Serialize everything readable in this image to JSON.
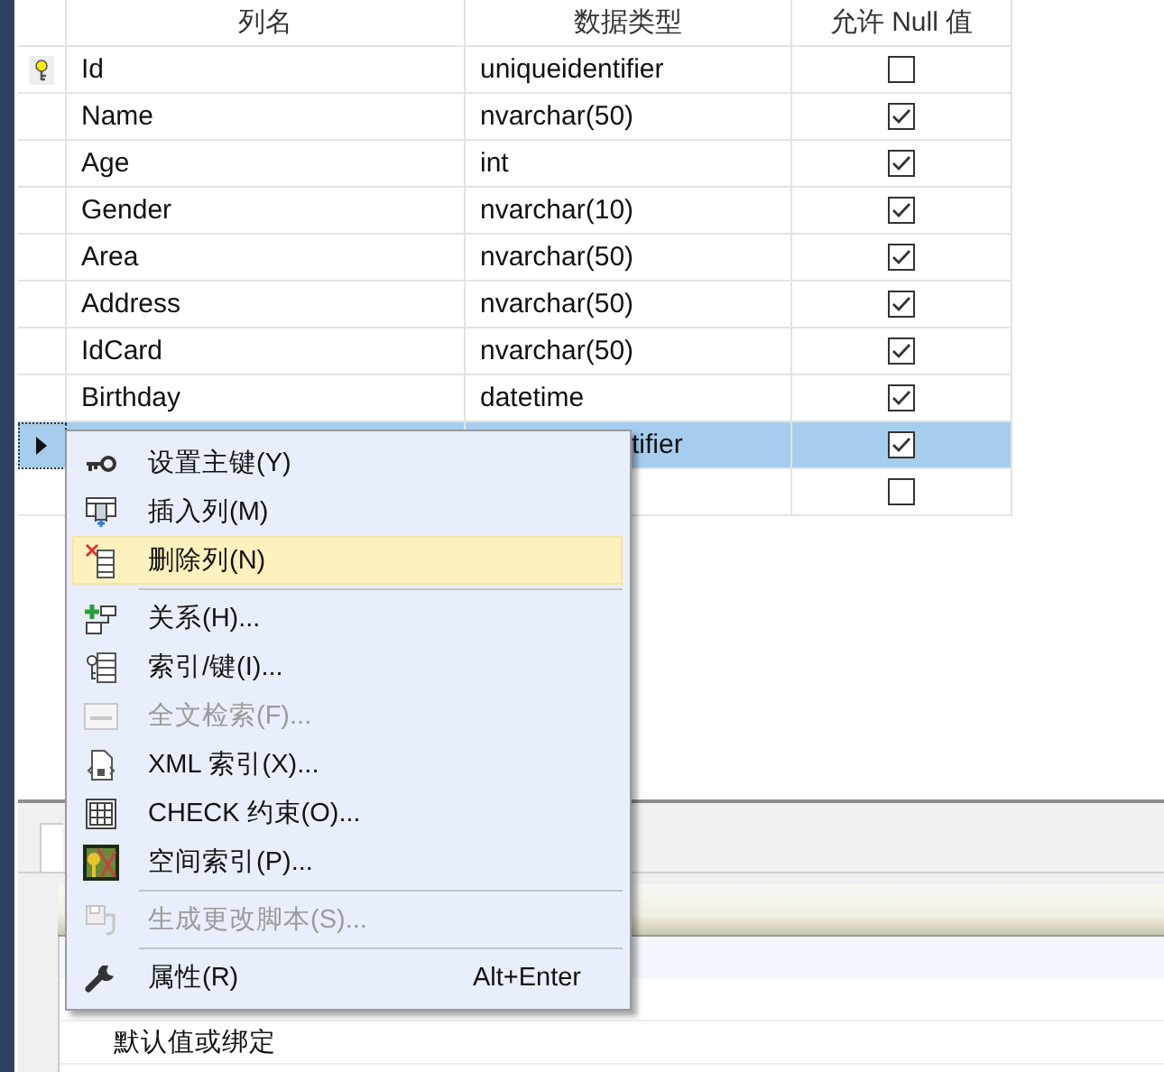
{
  "table": {
    "columns": [
      "列名",
      "数据类型",
      "允许 Null 值"
    ],
    "rows": [
      {
        "name": "Id",
        "data_type": "uniqueidentifier",
        "allow_null": false,
        "primary_key": true,
        "selected": false
      },
      {
        "name": "Name",
        "data_type": "nvarchar(50)",
        "allow_null": true,
        "primary_key": false,
        "selected": false
      },
      {
        "name": "Age",
        "data_type": "int",
        "allow_null": true,
        "primary_key": false,
        "selected": false
      },
      {
        "name": "Gender",
        "data_type": "nvarchar(10)",
        "allow_null": true,
        "primary_key": false,
        "selected": false
      },
      {
        "name": "Area",
        "data_type": "nvarchar(50)",
        "allow_null": true,
        "primary_key": false,
        "selected": false
      },
      {
        "name": "Address",
        "data_type": "nvarchar(50)",
        "allow_null": true,
        "primary_key": false,
        "selected": false
      },
      {
        "name": "IdCard",
        "data_type": "nvarchar(50)",
        "allow_null": true,
        "primary_key": false,
        "selected": false
      },
      {
        "name": "Birthday",
        "data_type": "datetime",
        "allow_null": true,
        "primary_key": false,
        "selected": false
      },
      {
        "data_type": "tifier",
        "allow_null": true,
        "primary_key": false,
        "selected": true
      },
      {
        "allow_null": false,
        "primary_key": false,
        "selected": false
      }
    ]
  },
  "context_menu": {
    "items": [
      {
        "kind": "item",
        "label": "设置主键(Y)",
        "disabled": false,
        "selected": false
      },
      {
        "kind": "item",
        "label": "插入列(M)",
        "disabled": false,
        "selected": false
      },
      {
        "kind": "item",
        "label": "删除列(N)",
        "disabled": false,
        "selected": true
      },
      {
        "kind": "separator"
      },
      {
        "kind": "item",
        "label": "关系(H)...",
        "disabled": false,
        "selected": false
      },
      {
        "kind": "item",
        "label": "索引/键(I)...",
        "disabled": false,
        "selected": false
      },
      {
        "kind": "item",
        "label": "全文检索(F)...",
        "disabled": true,
        "selected": false
      },
      {
        "kind": "item",
        "label": "XML 索引(X)...",
        "disabled": false,
        "selected": false
      },
      {
        "kind": "item",
        "label": "CHECK 约束(O)...",
        "disabled": false,
        "selected": false
      },
      {
        "kind": "item",
        "label": "空间索引(P)...",
        "disabled": false,
        "selected": false
      },
      {
        "kind": "separator"
      },
      {
        "kind": "item",
        "label": "生成更改脚本(S)...",
        "disabled": true,
        "selected": false
      },
      {
        "kind": "separator"
      },
      {
        "kind": "item",
        "label": "属性(R)",
        "shortcut": "Alt+Enter",
        "disabled": false,
        "selected": false
      }
    ]
  },
  "properties": {
    "rows": [
      {
        "label": "默认值或绑定"
      }
    ]
  }
}
